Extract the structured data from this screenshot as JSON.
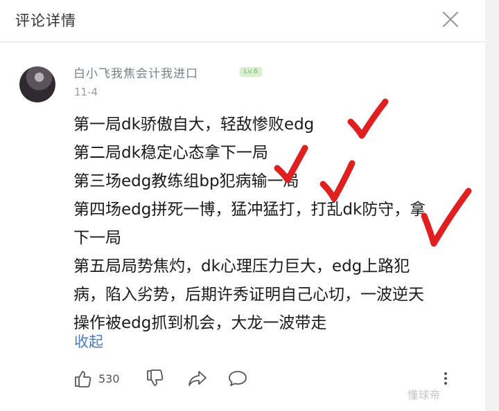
{
  "header": {
    "title": "评论详情"
  },
  "comment": {
    "username": "白小飞我焦会计我进口",
    "level_badge": "Lv.6",
    "date": "11-4",
    "lines": [
      "第一局dk骄傲自大，轻敌惨败edg",
      "第二局dk稳定心态拿下一局",
      "第三场edg教练组bp犯病输一局",
      "第四场edg拼死一博，猛冲猛打，打乱dk防守，拿",
      "下一局",
      "第五局局势焦灼，dk心理压力巨大，edg上路犯",
      "病，陷入劣势，后期许秀证明自己心切，一波逆天",
      "操作被edg抓到机会，大龙一波带走"
    ],
    "collapse_label": "收起",
    "likes": "530"
  },
  "icons": {
    "close": "close-icon",
    "like": "thumbs-up-icon",
    "dislike": "thumbs-down-icon",
    "share": "share-icon",
    "comment": "comment-icon",
    "more": "more-vertical-icon"
  },
  "colors": {
    "check_mark": "#e02020",
    "link": "#4a7bbf",
    "username": "#7a7f8a"
  },
  "watermark": "懂球帝"
}
